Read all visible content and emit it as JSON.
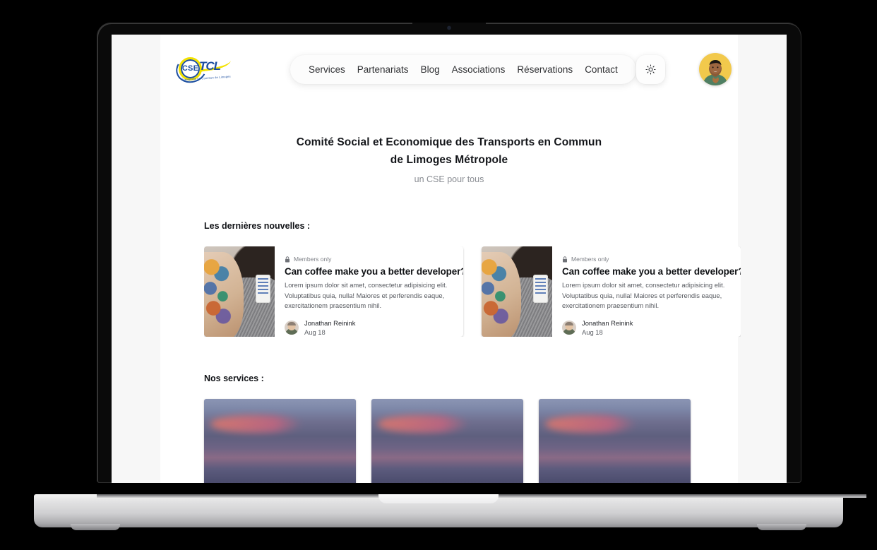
{
  "device": {
    "type": "laptop-mockup",
    "camera": "camera-dot"
  },
  "site": {
    "logo": {
      "badge_text": "CSE",
      "brand_text": "TCL",
      "tagline": "Transports en Commun de Limoges"
    },
    "nav": [
      {
        "label": "Services"
      },
      {
        "label": "Partenariats"
      },
      {
        "label": "Blog"
      },
      {
        "label": "Associations"
      },
      {
        "label": "Réservations"
      },
      {
        "label": "Contact"
      }
    ],
    "theme_toggle_icon": "sun-icon",
    "avatar_alt": "user-avatar"
  },
  "hero": {
    "title_line1": "Comité Social et Economique des Transports en Commun",
    "title_line2": "de Limoges Métropole",
    "subtitle": "un CSE pour tous"
  },
  "news": {
    "heading": "Les dernières nouvelles :",
    "cards": [
      {
        "badge_icon": "lock-icon",
        "badge": "Members only",
        "title": "Can coffee make you a better developer?",
        "excerpt": "Lorem ipsum dolor sit amet, consectetur adipisicing elit. Voluptatibus quia, nulla! Maiores et perferendis eaque, exercitationem praesentium nihil.",
        "author": "Jonathan Reinink",
        "date": "Aug 18"
      },
      {
        "badge_icon": "lock-icon",
        "badge": "Members only",
        "title": "Can coffee make you a better developer?",
        "excerpt": "Lorem ipsum dolor sit amet, consectetur adipisicing elit. Voluptatibus quia, nulla! Maiores et perferendis eaque, exercitationem praesentium nihil.",
        "author": "Jonathan Reinink",
        "date": "Aug 18"
      }
    ]
  },
  "services": {
    "heading": "Nos services :",
    "cards": [
      {
        "image_alt": "sunset-sky-photo"
      },
      {
        "image_alt": "sunset-sky-photo"
      },
      {
        "image_alt": "sunset-sky-photo"
      }
    ]
  },
  "colors": {
    "page_bg": "#f7f7f7",
    "content_bg": "#ffffff",
    "text_primary": "#14161a",
    "text_muted": "#8a8d93",
    "logo_blue": "#1d4fa0",
    "logo_yellow": "#f3e200",
    "avatar_bg": "#f2c94c",
    "bezel": "#0a0a0a"
  }
}
